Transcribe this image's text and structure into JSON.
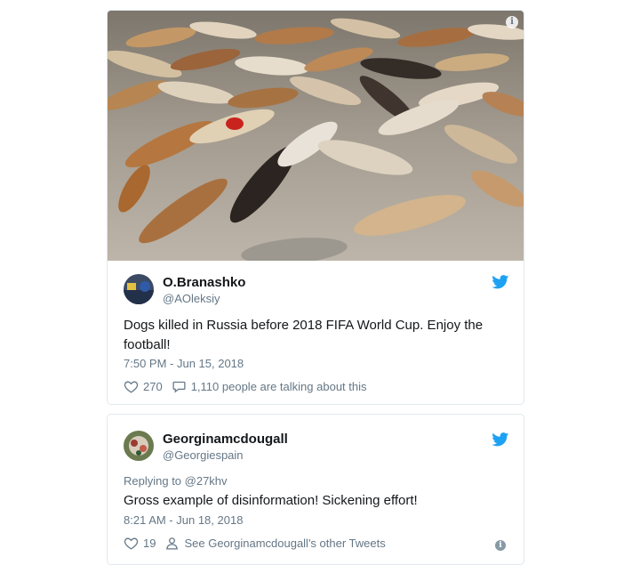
{
  "tweets": [
    {
      "name": "O.Branashko",
      "handle": "@AOleksiy",
      "text": "Dogs killed in Russia before 2018 FIFA World Cup. Enjoy the football!",
      "timestamp": "7:50 PM - Jun 15, 2018",
      "likes": "270",
      "conversation": "1,110 people are talking about this",
      "media_info_icon": "i",
      "icons": {
        "like": "heart-icon",
        "reply": "speech-bubble-icon",
        "brand": "twitter-bird-icon"
      }
    },
    {
      "name": "Georginamcdougall",
      "handle": "@Georgiespain",
      "replying_to": "Replying to @27khv",
      "text": "Gross example of disinformation! Sickening effort!",
      "timestamp": "8:21 AM - Jun 18, 2018",
      "likes": "19",
      "profile_link": "See Georginamcdougall's other Tweets",
      "info_icon": "i",
      "icons": {
        "like": "heart-icon",
        "profile": "person-icon",
        "brand": "twitter-bird-icon"
      }
    }
  ],
  "colors": {
    "twitter_blue": "#1da1f2",
    "secondary_text": "#657786",
    "border": "#e1e8ed"
  }
}
